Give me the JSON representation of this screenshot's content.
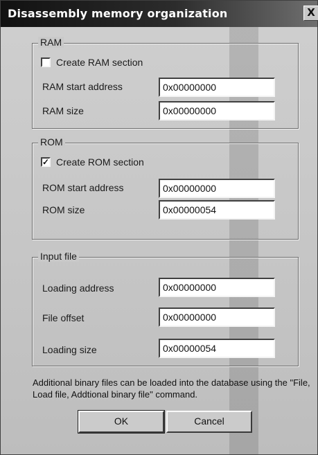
{
  "window": {
    "title": "Disassembly memory organization",
    "close_glyph": "X"
  },
  "ram": {
    "group_label": "RAM",
    "checkbox_label": "Create RAM section",
    "checked": false,
    "start_label": "RAM start address",
    "start_value": "0x00000000",
    "size_label": "RAM size",
    "size_value": "0x00000000"
  },
  "rom": {
    "group_label": "ROM",
    "checkbox_label": "Create ROM section",
    "checked": true,
    "check_glyph": "✓",
    "start_label": "ROM start address",
    "start_value": "0x00000000",
    "size_label": "ROM size",
    "size_value": "0x00000054"
  },
  "input_file": {
    "group_label": "Input file",
    "loading_address_label": "Loading address",
    "loading_address_value": "0x00000000",
    "file_offset_label": "File offset",
    "file_offset_value": "0x00000000",
    "loading_size_label": "Loading size",
    "loading_size_value": "0x00000054"
  },
  "note": {
    "text": "Additional binary files can be loaded into the database using the \"File, Load file, Addtional binary file\" command."
  },
  "buttons": {
    "ok": "OK",
    "cancel": "Cancel"
  }
}
